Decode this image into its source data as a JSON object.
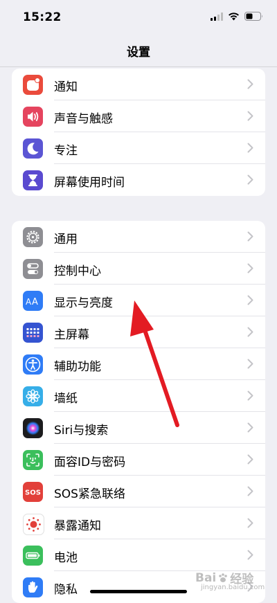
{
  "status_bar": {
    "time": "15:22"
  },
  "nav": {
    "title": "设置"
  },
  "group1": [
    {
      "label": "通知",
      "icon": "bell-badge-icon",
      "color": "#ea4b3c"
    },
    {
      "label": "声音与触感",
      "icon": "speaker-icon",
      "color": "#e5445e"
    },
    {
      "label": "专注",
      "icon": "moon-icon",
      "color": "#5b55d4"
    },
    {
      "label": "屏幕使用时间",
      "icon": "hourglass-icon",
      "color": "#5a4ad0"
    }
  ],
  "group2": [
    {
      "label": "通用",
      "icon": "gear-icon",
      "color": "#8e8e93"
    },
    {
      "label": "控制中心",
      "icon": "toggles-icon",
      "color": "#8e8e93"
    },
    {
      "label": "显示与亮度",
      "icon": "text-size-icon",
      "color": "#2f7cf6"
    },
    {
      "label": "主屏幕",
      "icon": "grid-icon",
      "color": "#3554d1"
    },
    {
      "label": "辅助功能",
      "icon": "accessibility-icon",
      "color": "#2f7cf6"
    },
    {
      "label": "墙纸",
      "icon": "flower-icon",
      "color": "#36aee8"
    },
    {
      "label": "Siri与搜索",
      "icon": "siri-icon",
      "color": "#1c1c1e"
    },
    {
      "label": "面容ID与密码",
      "icon": "face-id-icon",
      "color": "#3bbf5c"
    },
    {
      "label": "SOS紧急联络",
      "icon": "sos-icon",
      "color": "#e2403a"
    },
    {
      "label": "暴露通知",
      "icon": "exposure-icon",
      "color": "#ffffff"
    },
    {
      "label": "电池",
      "icon": "battery-icon",
      "color": "#3bbf5c"
    },
    {
      "label": "隐私",
      "icon": "hand-icon",
      "color": "#2f7cf6"
    }
  ],
  "watermark": {
    "text": "Bai",
    "text2": "经验",
    "sub": "jingyan.baidu.com"
  }
}
